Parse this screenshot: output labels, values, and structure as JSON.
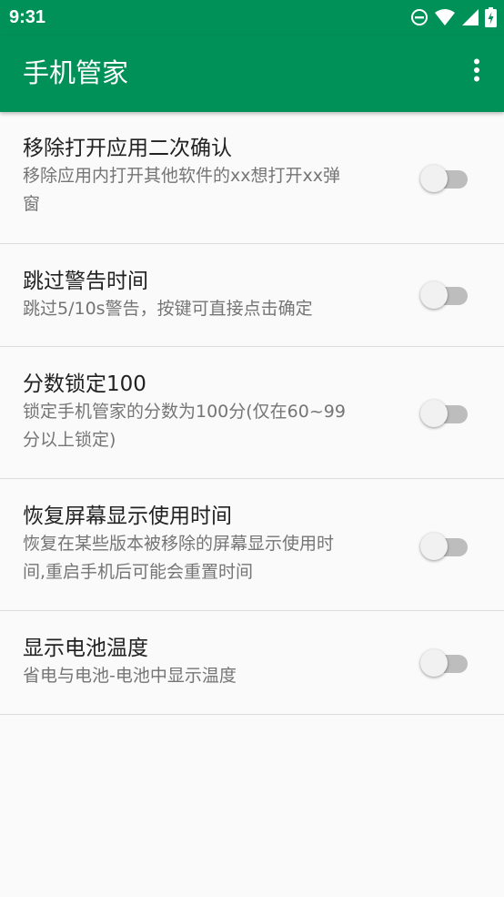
{
  "status_bar": {
    "time": "9:31",
    "icons": [
      "do-not-disturb-icon",
      "wifi-icon",
      "signal-icon",
      "battery-charging-icon"
    ]
  },
  "app_bar": {
    "title": "手机管家",
    "overflow_icon": "more-vert-icon"
  },
  "colors": {
    "primary": "#009159",
    "background": "#fafafa",
    "title_text": "#212121",
    "summary_text": "#757575"
  },
  "settings": [
    {
      "title": "移除打开应用二次确认",
      "summary_line1": "移除应用内打开其他软件的xx想打开xx弹",
      "summary_line2": "窗",
      "enabled": false
    },
    {
      "title": "跳过警告时间",
      "summary_line1": "跳过5/10s警告，按键可直接点击确定",
      "summary_line2": "",
      "enabled": false
    },
    {
      "title": "分数锁定100",
      "summary_line1": "锁定手机管家的分数为100分(仅在60~99",
      "summary_line2": "分以上锁定)",
      "enabled": false
    },
    {
      "title": "恢复屏幕显示使用时间",
      "summary_line1": "恢复在某些版本被移除的屏幕显示使用时",
      "summary_line2": "间,重启手机后可能会重置时间",
      "enabled": false
    },
    {
      "title": "显示电池温度",
      "summary_line1": "省电与电池-电池中显示温度",
      "summary_line2": "",
      "enabled": false
    }
  ]
}
